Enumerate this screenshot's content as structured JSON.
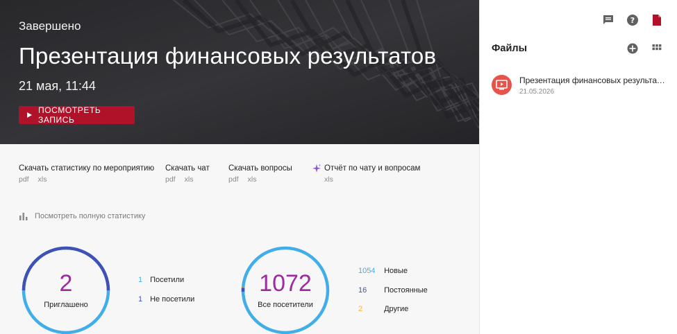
{
  "event": {
    "status": "Завершено",
    "title": "Презентация финансовых результатов",
    "date": "21 мая, 11:44",
    "watch_button": "ПОСМОТРЕТЬ ЗАПИСЬ"
  },
  "downloads": [
    {
      "title": "Скачать статистику по мероприятию",
      "formats": [
        "pdf",
        "xls"
      ]
    },
    {
      "title": "Скачать чат",
      "formats": [
        "pdf",
        "xls"
      ]
    },
    {
      "title": "Скачать вопросы",
      "formats": [
        "pdf",
        "xls"
      ]
    },
    {
      "title": "Отчёт по чату и вопросам",
      "formats": [
        "xls"
      ]
    }
  ],
  "full_stats_link": "Посмотреть полную статистику",
  "invited": {
    "total": "2",
    "label": "Приглашено",
    "legend": [
      {
        "value": "1",
        "label": "Посетили",
        "color": "#42aee8"
      },
      {
        "value": "1",
        "label": "Не посетили",
        "color": "#3f51b5"
      }
    ],
    "ring_share": {
      "visited": 0.5,
      "not_visited": 0.5
    }
  },
  "visitors": {
    "total": "1072",
    "label": "Все посетители",
    "legend": [
      {
        "value": "1054",
        "label": "Новые",
        "color": "#42aee8"
      },
      {
        "value": "16",
        "label": "Постоянные",
        "color": "#3f51b5"
      },
      {
        "value": "2",
        "label": "Другие",
        "color": "#f2b23e"
      }
    ],
    "ring_share": {
      "new": 1054,
      "regular": 16,
      "other": 2
    }
  },
  "sidebar": {
    "icons": [
      "chat-icon",
      "help-icon",
      "document-icon"
    ],
    "files_title": "Файлы",
    "files": [
      {
        "name": "Презентация финансовых результатов",
        "date": "21.05.2026"
      }
    ]
  },
  "colors": {
    "accent_red": "#b0122a",
    "number_purple": "#9d2a9f",
    "ring_light_blue": "#42aee8",
    "ring_dark_blue": "#3f51b5",
    "other_orange": "#f2b23e",
    "file_thumb": "#e5534b"
  }
}
